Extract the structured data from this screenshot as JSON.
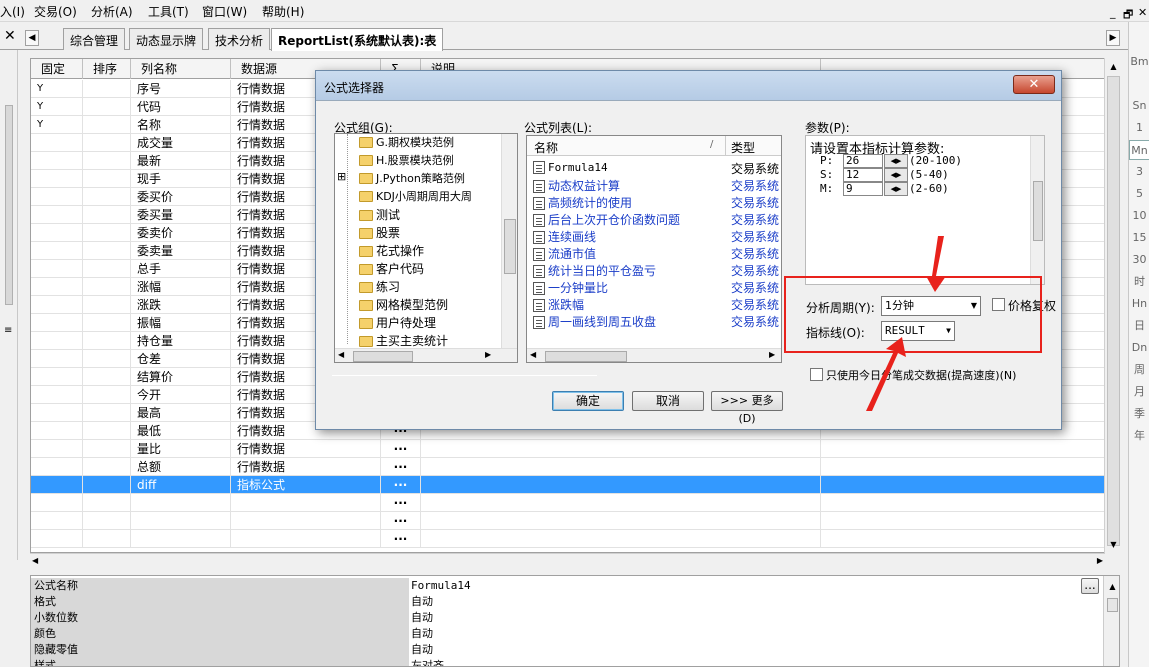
{
  "menu": [
    "入(I)",
    "交易(O)",
    "分析(A)",
    "工具(T)",
    "窗口(W)",
    "帮助(H)"
  ],
  "window_controls": [
    "_",
    "🗗",
    "✕"
  ],
  "tabs": [
    "综合管理",
    "动态显示牌",
    "技术分析",
    "ReportList(系统默认表):表"
  ],
  "table": {
    "headers": [
      "固定",
      "排序",
      "列名称",
      "数据源",
      "Σ",
      "说明"
    ],
    "rows": [
      {
        "fixed": "Y",
        "name": "序号",
        "source": "行情数据",
        "sigma": ""
      },
      {
        "fixed": "Y",
        "name": "代码",
        "source": "行情数据",
        "sigma": ""
      },
      {
        "fixed": "Y",
        "name": "名称",
        "source": "行情数据",
        "sigma": ""
      },
      {
        "fixed": "",
        "name": "成交量",
        "source": "行情数据",
        "sigma": ""
      },
      {
        "fixed": "",
        "name": "最新",
        "source": "行情数据",
        "sigma": ""
      },
      {
        "fixed": "",
        "name": "现手",
        "source": "行情数据",
        "sigma": ""
      },
      {
        "fixed": "",
        "name": "委买价",
        "source": "行情数据",
        "sigma": ""
      },
      {
        "fixed": "",
        "name": "委买量",
        "source": "行情数据",
        "sigma": ""
      },
      {
        "fixed": "",
        "name": "委卖价",
        "source": "行情数据",
        "sigma": ""
      },
      {
        "fixed": "",
        "name": "委卖量",
        "source": "行情数据",
        "sigma": ""
      },
      {
        "fixed": "",
        "name": "总手",
        "source": "行情数据",
        "sigma": ""
      },
      {
        "fixed": "",
        "name": "涨幅",
        "source": "行情数据",
        "sigma": ""
      },
      {
        "fixed": "",
        "name": "涨跌",
        "source": "行情数据",
        "sigma": ""
      },
      {
        "fixed": "",
        "name": "振幅",
        "source": "行情数据",
        "sigma": ""
      },
      {
        "fixed": "",
        "name": "持仓量",
        "source": "行情数据",
        "sigma": ""
      },
      {
        "fixed": "",
        "name": "仓差",
        "source": "行情数据",
        "sigma": ""
      },
      {
        "fixed": "",
        "name": "结算价",
        "source": "行情数据",
        "sigma": ""
      },
      {
        "fixed": "",
        "name": "今开",
        "source": "行情数据",
        "sigma": ""
      },
      {
        "fixed": "",
        "name": "最高",
        "source": "行情数据",
        "sigma": "···"
      },
      {
        "fixed": "",
        "name": "最低",
        "source": "行情数据",
        "sigma": "···"
      },
      {
        "fixed": "",
        "name": "量比",
        "source": "行情数据",
        "sigma": "···"
      },
      {
        "fixed": "",
        "name": "总额",
        "source": "行情数据",
        "sigma": "···"
      },
      {
        "fixed": "",
        "name": "diff",
        "source": "指标公式",
        "sigma": "···",
        "selected": true
      },
      {
        "fixed": "",
        "name": "",
        "source": "",
        "sigma": "···"
      },
      {
        "fixed": "",
        "name": "",
        "source": "",
        "sigma": "···"
      },
      {
        "fixed": "",
        "name": "",
        "source": "",
        "sigma": "···"
      }
    ]
  },
  "right_sidebar": [
    "",
    "Bm",
    "",
    "Sn",
    "1",
    "Mn",
    "3",
    "5",
    "10",
    "15",
    "30",
    "时",
    "Hn",
    "日",
    "Dn",
    "周",
    "月",
    "季",
    "年"
  ],
  "properties": [
    {
      "key": "公式名称",
      "value": "Formula14"
    },
    {
      "key": "格式",
      "value": "自动"
    },
    {
      "key": "小数位数",
      "value": "自动"
    },
    {
      "key": "颜色",
      "value": "自动"
    },
    {
      "key": "隐藏零值",
      "value": "自动"
    },
    {
      "key": "样式",
      "value": "左对齐"
    }
  ],
  "props_button": "...",
  "dialog": {
    "title": "公式选择器",
    "close": "✕",
    "group_label": "公式组(G):",
    "groups": [
      "G.期权模块范例",
      "H.股票模块范例",
      "J.Python策略范例",
      "KDJ小周期周用大周",
      "测试",
      "股票",
      "花式操作",
      "客户代码",
      "练习",
      "网格模型范例",
      "用户待处理",
      "主买主卖统计"
    ],
    "list_label": "公式列表(L):",
    "list_headers": {
      "name": "名称",
      "type": "类型"
    },
    "formulas": [
      {
        "name": "Formula14",
        "type": "交易系统"
      },
      {
        "name": "动态权益计算",
        "type": "交易系统"
      },
      {
        "name": "高频统计的使用",
        "type": "交易系统"
      },
      {
        "name": "后台上次开仓价函数问题",
        "type": "交易系统"
      },
      {
        "name": "连续画线",
        "type": "交易系统"
      },
      {
        "name": "流通市值",
        "type": "交易系统"
      },
      {
        "name": "统计当日的平仓盈亏",
        "type": "交易系统"
      },
      {
        "name": "一分钟量比",
        "type": "交易系统"
      },
      {
        "name": "涨跌幅",
        "type": "交易系统"
      },
      {
        "name": "周一画线到周五收盘",
        "type": "交易系统"
      }
    ],
    "params_label": "参数(P):",
    "params_title": "请设置本指标计算参数:",
    "params": [
      {
        "name": "P:",
        "value": "26",
        "range": "(20-100)"
      },
      {
        "name": "S:",
        "value": "12",
        "range": "(5-40)"
      },
      {
        "name": "M:",
        "value": "9",
        "range": "(2-60)"
      }
    ],
    "period_label": "分析周期(Y):",
    "period_value": "1分钟",
    "price_adjust_label": "价格复权",
    "indicator_label": "指标线(O):",
    "indicator_value": "RESULT",
    "only_today_label": "只使用今日分笔成交数据(提高速度)(N)",
    "ok": "确定",
    "cancel": "取消",
    "more": ">>> 更多(D)"
  },
  "colors": {
    "highlight_box": "#e8221c",
    "selection": "#3399ff",
    "link_blue": "#1a3dc8"
  }
}
